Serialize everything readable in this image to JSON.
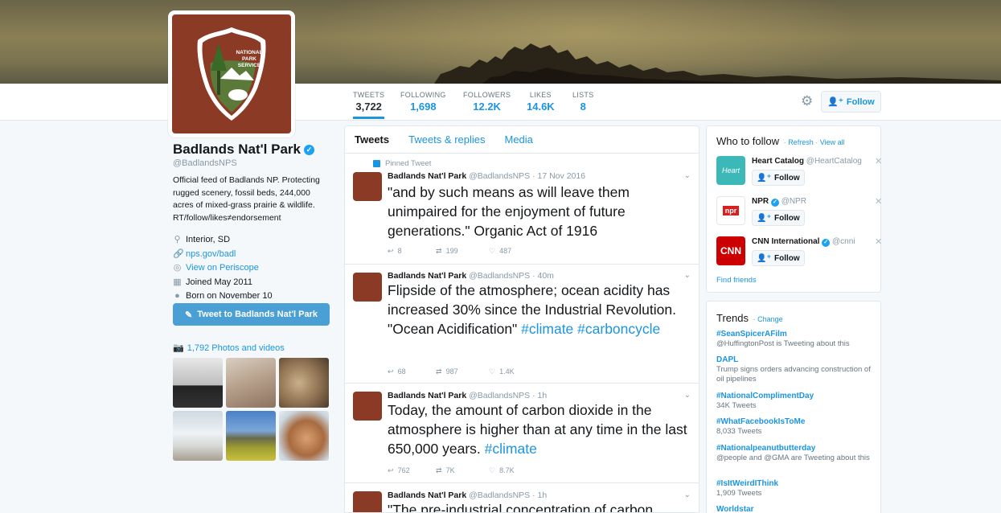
{
  "stats": [
    {
      "label": "TWEETS",
      "value": "3,722"
    },
    {
      "label": "FOLLOWING",
      "value": "1,698"
    },
    {
      "label": "FOLLOWERS",
      "value": "12.2K"
    },
    {
      "label": "LIKES",
      "value": "14.6K"
    },
    {
      "label": "LISTS",
      "value": "8"
    }
  ],
  "header": {
    "follow_label": "Follow",
    "logo_text": "NATIONAL PARK SERVICE"
  },
  "profile": {
    "name": "Badlands Nat'l Park",
    "handle": "@BadlandsNPS",
    "bio": "Official feed of Badlands NP. Protecting rugged scenery, fossil beds, 244,000 acres of mixed-grass prairie & wildlife. RT/follow/likes≠endorsement",
    "location": "Interior, SD",
    "website": "nps.gov/badl",
    "periscope": "View on Periscope",
    "joined": "Joined May 2011",
    "born": "Born on November 10",
    "tweet_to_label": "Tweet to Badlands Nat'l Park",
    "photos_label": "1,792 Photos and videos"
  },
  "tabs": [
    "Tweets",
    "Tweets & replies",
    "Media"
  ],
  "tweets": [
    {
      "pinned_label": "Pinned Tweet",
      "name": "Badlands Nat'l Park",
      "handle": "@BadlandsNPS",
      "time": "· 17 Nov 2016",
      "text": "\"and by such means as will leave them unimpaired for the enjoyment of future generations.\" Organic Act of 1916",
      "hashtags": "",
      "replies": "8",
      "retweets": "199",
      "likes": "487"
    },
    {
      "name": "Badlands Nat'l Park",
      "handle": "@BadlandsNPS",
      "time": "· 40m",
      "text": "Flipside of the atmosphere; ocean acidity has increased 30% since the Industrial Revolution. \"Ocean Acidification\" ",
      "hashtags": "#climate #carboncycle",
      "replies": "68",
      "retweets": "987",
      "likes": "1.4K"
    },
    {
      "name": "Badlands Nat'l Park",
      "handle": "@BadlandsNPS",
      "time": "· 1h",
      "text": "Today, the amount of carbon dioxide in the atmosphere is higher than at any time in the last 650,000 years. ",
      "hashtags": "#climate",
      "replies": "762",
      "retweets": "7K",
      "likes": "8.7K"
    },
    {
      "name": "Badlands Nat'l Park",
      "handle": "@BadlandsNPS",
      "time": "· 1h",
      "text": "\"The pre-industrial concentration of carbon",
      "hashtags": "",
      "replies": "",
      "retweets": "",
      "likes": ""
    }
  ],
  "who_to_follow": {
    "title": "Who to follow",
    "refresh": "Refresh",
    "view_all": "View all",
    "items": [
      {
        "name": "Heart Catalog",
        "handle": "@HeartCatalog",
        "follow": "Follow",
        "avatar_text": "Heart",
        "color": "#3cb8b8"
      },
      {
        "name": "NPR",
        "handle": "@NPR",
        "follow": "Follow",
        "avatar_text": "npr",
        "color": "#ffffff"
      },
      {
        "name": "CNN International",
        "handle": "@cnni",
        "follow": "Follow",
        "avatar_text": "CNN",
        "color": "#cc0000"
      }
    ],
    "find_friends": "Find friends"
  },
  "trends": {
    "title": "Trends",
    "change": "Change",
    "items": [
      {
        "name": "#SeanSpicerAFilm",
        "desc": "@HuffingtonPost is Tweeting about this"
      },
      {
        "name": "DAPL",
        "desc": "Trump signs orders advancing construction of oil pipelines"
      },
      {
        "name": "#NationalComplimentDay",
        "desc": "34K Tweets"
      },
      {
        "name": "#WhatFacebookIsToMe",
        "desc": "8,033 Tweets"
      },
      {
        "name": "#Nationalpeanutbutterday",
        "desc": "@people and @GMA are Tweeting about this"
      },
      {
        "name": "#IsItWeirdIThink",
        "desc": "1,909 Tweets"
      },
      {
        "name": "Worldstar",
        "desc": ""
      }
    ]
  },
  "colors": {
    "accent": "#1b95e0",
    "nps_brown": "#8a3a25",
    "tweet_button": "#4aa0d5"
  }
}
